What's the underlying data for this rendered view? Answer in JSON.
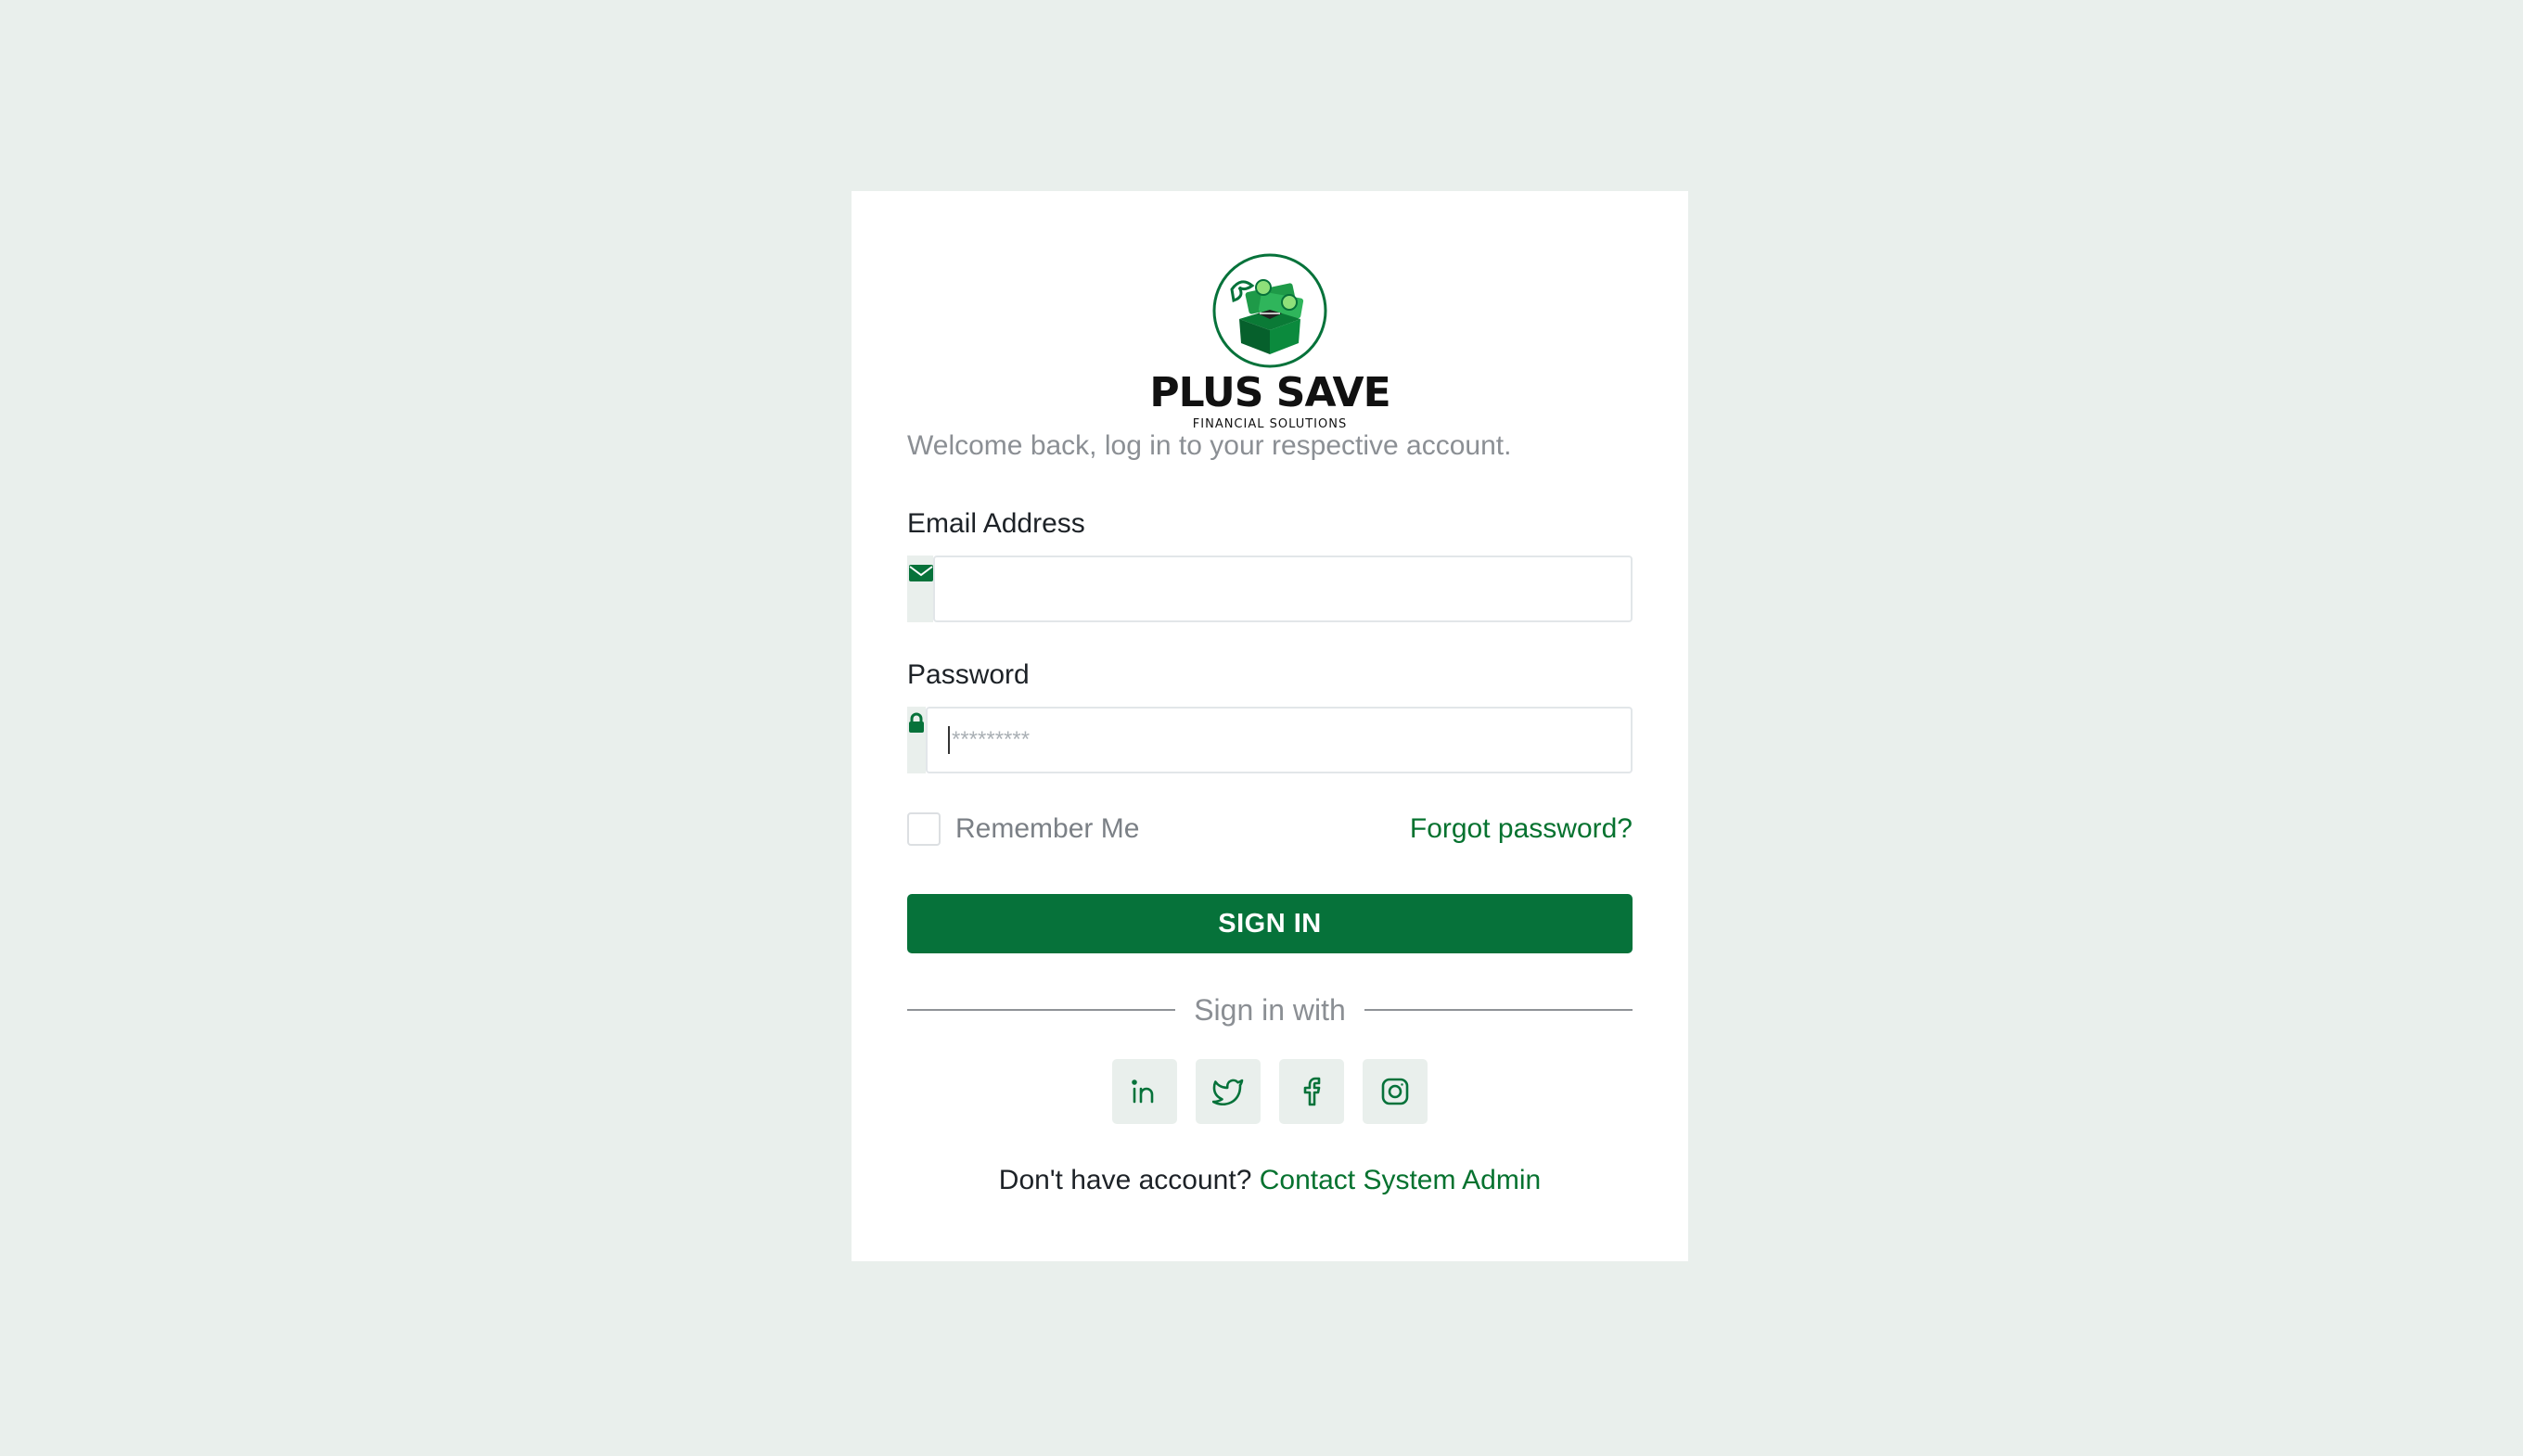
{
  "brand": {
    "name": "PLUS SAVE",
    "tagline": "FINANCIAL SOLUTIONS",
    "primary_color": "#06723a",
    "logo_icon": "money-box-logo"
  },
  "welcome_text": "Welcome back, log in to your respective account.",
  "email": {
    "label": "Email Address",
    "value": "",
    "placeholder": "",
    "icon": "envelope-icon"
  },
  "password": {
    "label": "Password",
    "value": "",
    "placeholder": "*********",
    "icon": "lock-icon"
  },
  "remember_me": {
    "label": "Remember Me",
    "checked": false
  },
  "forgot_password_label": "Forgot password?",
  "sign_in_label": "SIGN IN",
  "divider_label": "Sign in with",
  "social": [
    "linkedin-icon",
    "twitter-icon",
    "facebook-icon",
    "instagram-icon"
  ],
  "footer": {
    "question": "Don't have account?",
    "link_label": "Contact System Admin"
  }
}
